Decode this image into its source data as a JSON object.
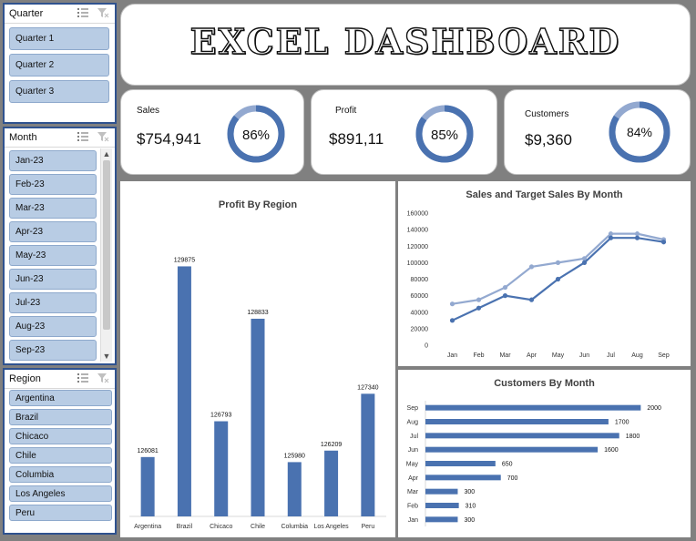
{
  "dashboard": {
    "title": "EXCEL DASHBOARD"
  },
  "slicers": {
    "quarter": {
      "title": "Quarter",
      "items": [
        "Quarter 1",
        "Quarter 2",
        "Quarter 3"
      ]
    },
    "month": {
      "title": "Month",
      "items": [
        "Jan-23",
        "Feb-23",
        "Mar-23",
        "Apr-23",
        "May-23",
        "Jun-23",
        "Jul-23",
        "Aug-23",
        "Sep-23"
      ]
    },
    "region": {
      "title": "Region",
      "items": [
        "Argentina",
        "Brazil",
        "Chicaco",
        "Chile",
        "Columbia",
        "Los Angeles",
        "Peru"
      ]
    }
  },
  "kpis": {
    "sales": {
      "label": "Sales",
      "value": "$754,941",
      "percent_label": "86%",
      "percent": 0.86
    },
    "profit": {
      "label": "Profit",
      "value": "$891,11",
      "percent_label": "85%",
      "percent": 0.85
    },
    "customers": {
      "label": "Customers",
      "value": "$9,360",
      "percent_label": "84%",
      "percent": 0.84
    }
  },
  "colors": {
    "accent": "#4a72b0",
    "accent_light": "#93a9d0",
    "slicer_item": "#b8cce4"
  },
  "chart_data": [
    {
      "type": "bar",
      "title": "Profit By Region",
      "categories": [
        "Argentina",
        "Brazil",
        "Chicaco",
        "Chile",
        "Columbia",
        "Los Angeles",
        "Peru"
      ],
      "values": [
        126081,
        129875,
        126793,
        128833,
        125980,
        126209,
        127340
      ],
      "data_labels": [
        "126081",
        "129875",
        "126793",
        "128833",
        "125980",
        "126209",
        "127340"
      ],
      "ylim": [
        124900,
        130300
      ]
    },
    {
      "type": "line",
      "title": "Sales and Target Sales By Month",
      "categories": [
        "Jan",
        "Feb",
        "Mar",
        "Apr",
        "May",
        "Jun",
        "Jul",
        "Aug",
        "Sep"
      ],
      "yticks": [
        "0",
        "20000",
        "40000",
        "60000",
        "80000",
        "100000",
        "120000",
        "140000",
        "160000"
      ],
      "ylim": [
        0,
        160000
      ],
      "series": [
        {
          "values": [
            30000,
            45000,
            60000,
            55000,
            80000,
            100000,
            130000,
            130000,
            125000
          ]
        },
        {
          "values": [
            50000,
            55000,
            70000,
            95000,
            100000,
            105000,
            135000,
            135000,
            128000
          ]
        }
      ]
    },
    {
      "type": "bar",
      "orientation": "horizontal",
      "title": "Customers By Month",
      "categories": [
        "Sep",
        "Aug",
        "Jul",
        "Jun",
        "May",
        "Apr",
        "Mar",
        "Feb",
        "Jan"
      ],
      "values": [
        2000,
        1700,
        1800,
        1600,
        650,
        700,
        300,
        310,
        300
      ],
      "data_labels": [
        "2000",
        "1700",
        "1800",
        "1600",
        "650",
        "700",
        "300",
        "310",
        "300"
      ],
      "xlim": [
        0,
        2200
      ]
    }
  ]
}
